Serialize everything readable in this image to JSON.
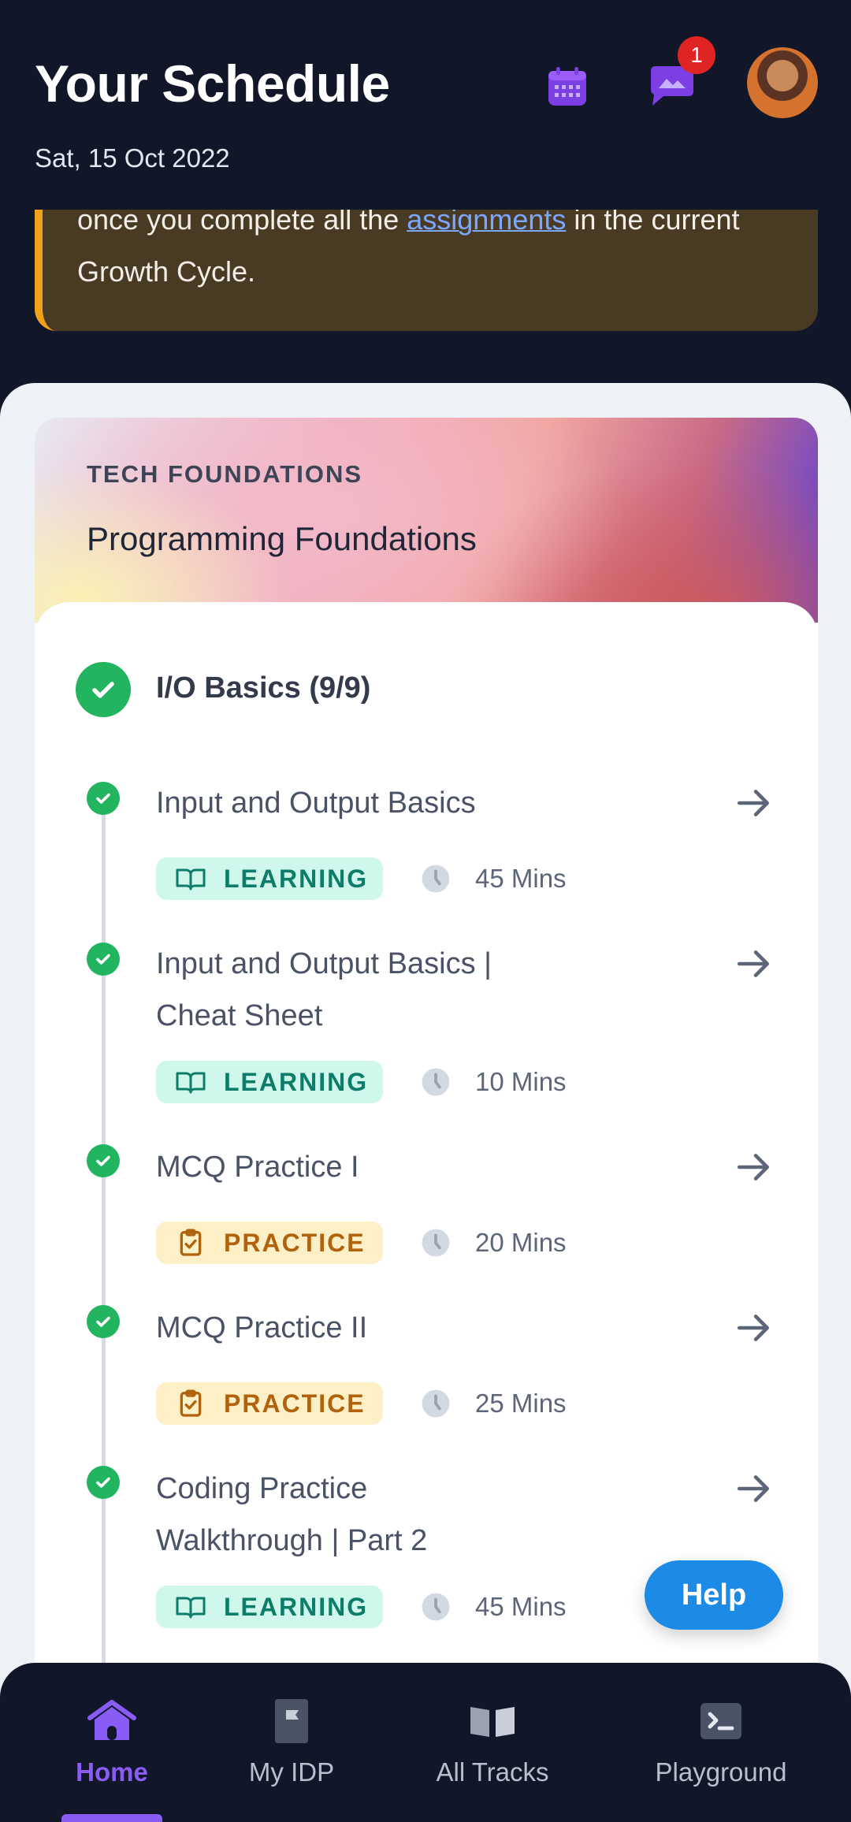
{
  "header": {
    "title": "Your Schedule",
    "date": "Sat, 15 Oct 2022",
    "notifications_count": "1"
  },
  "notice": {
    "text_before": "once you complete all the ",
    "link_text": "assignments",
    "text_after": "  in the current Growth Cycle."
  },
  "track": {
    "eyebrow": "TECH FOUNDATIONS",
    "name": "Programming Foundations",
    "section_title": "I/O Basics (9/9)",
    "items": [
      {
        "title": "Input and Output Basics",
        "type": "LEARNING",
        "duration": "45 Mins"
      },
      {
        "title": "Input and Output Basics | Cheat Sheet",
        "type": "LEARNING",
        "duration": "10 Mins"
      },
      {
        "title": "MCQ Practice I",
        "type": "PRACTICE",
        "duration": "20 Mins"
      },
      {
        "title": "MCQ Practice II",
        "type": "PRACTICE",
        "duration": "25 Mins"
      },
      {
        "title": "Coding Practice Walkthrough | Part 2",
        "type": "LEARNING",
        "duration": "45 Mins"
      }
    ]
  },
  "help_label": "Help",
  "nav": {
    "items": [
      {
        "label": "Home",
        "icon": "home-icon"
      },
      {
        "label": "My IDP",
        "icon": "flag-icon"
      },
      {
        "label": "All Tracks",
        "icon": "book-icon"
      },
      {
        "label": "Playground",
        "icon": "terminal-icon"
      }
    ],
    "active": "Home"
  },
  "colors": {
    "background": "#111729",
    "accent": "#8a5cf6",
    "success": "#22b45e",
    "learning_bg": "#cff7ec",
    "learning_text": "#0d7d69",
    "practice_bg": "#fdf0c7",
    "practice_text": "#b0620c",
    "help": "#1d8ae6"
  }
}
